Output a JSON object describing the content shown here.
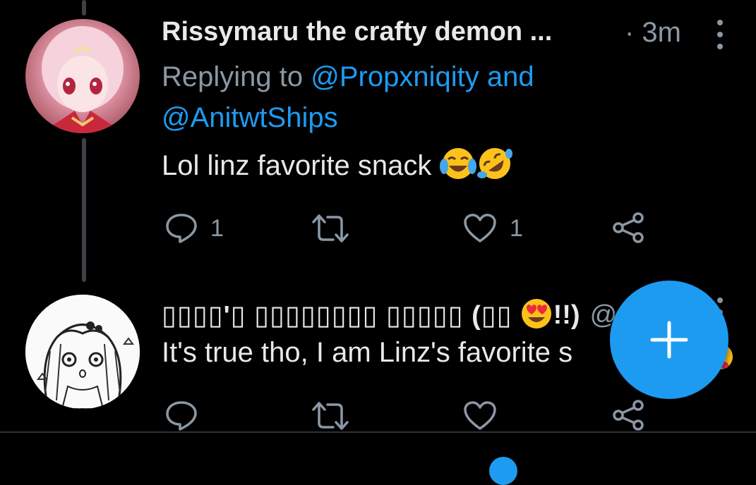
{
  "tweet1": {
    "display_name": "Rissymaru the crafty demon ...",
    "time": "· 3m",
    "replying_prefix": "Replying to",
    "replying_handle_1": "@Propxniqity",
    "replying_joiner": "and",
    "replying_handle_2": "@AnitwtShips",
    "text": "Lol linz favorite snack",
    "emojis": [
      "face-with-tears-of-joy",
      "rolling-on-floor-laughing"
    ],
    "reply_count": "1",
    "retweet_count": "",
    "like_count": "1"
  },
  "tweet2": {
    "display_name": "▯▯▯▯'▯ ▯▯▯▯▯▯▯▯ ▯▯▯▯▯ (▯▯",
    "name_suffix": "!!)",
    "handle": "@...",
    "text": "It's true tho, I am Linz's favorite s",
    "emojis": [
      "smiling-face-with-heart-eyes"
    ]
  },
  "fab": {
    "icon": "plus-icon"
  },
  "colors": {
    "accent": "#1d9bf0",
    "background": "#000000",
    "secondary_text": "#8b98a5"
  }
}
